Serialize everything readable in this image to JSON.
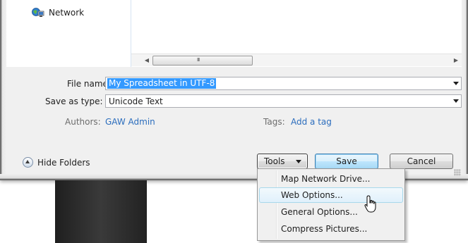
{
  "nav": {
    "network_label": "Network"
  },
  "scrollbar": {
    "grip": "III"
  },
  "form": {
    "file_name_label": "File name:",
    "file_name_value": "My Spreadsheet in UTF-8",
    "save_as_type_label": "Save as type:",
    "save_as_type_value": "Unicode Text",
    "authors_label": "Authors:",
    "authors_value": "GAW Admin",
    "tags_label": "Tags:",
    "tags_value": "Add a tag"
  },
  "buttons": {
    "hide_folders": "Hide Folders",
    "tools": "Tools",
    "save": "Save",
    "cancel": "Cancel"
  },
  "tools_menu": {
    "items": [
      "Map Network Drive...",
      "Web Options...",
      "General Options...",
      "Compress Pictures..."
    ],
    "highlighted": "Web Options..."
  },
  "colors": {
    "selection": "#3399ff",
    "link": "#2b6dbd",
    "save_button": "#bee6fd"
  }
}
